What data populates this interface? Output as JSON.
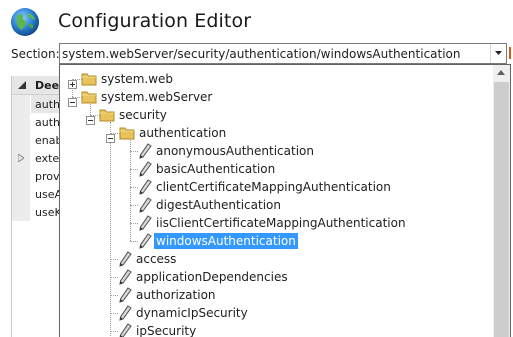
{
  "header": {
    "title": "Configuration Editor",
    "globe_icon": "globe-icon"
  },
  "section": {
    "label": "Section:",
    "value": "system.webServer/security/authentication/windowsAuthentication"
  },
  "grid": {
    "header": "Dee",
    "rows": [
      "auth",
      "auth",
      "enab",
      "exter",
      "prov",
      "useA",
      "useK"
    ]
  },
  "tree": {
    "items": [
      {
        "label": "system.web",
        "type": "folder",
        "level": 1,
        "toggle": "+"
      },
      {
        "label": "system.webServer",
        "type": "folder",
        "level": 1,
        "toggle": "-"
      },
      {
        "label": "security",
        "type": "folder",
        "level": 2,
        "toggle": "-"
      },
      {
        "label": "authentication",
        "type": "folder",
        "level": 3,
        "toggle": "-"
      },
      {
        "label": "anonymousAuthentication",
        "type": "section",
        "level": 4
      },
      {
        "label": "basicAuthentication",
        "type": "section",
        "level": 4
      },
      {
        "label": "clientCertificateMappingAuthentication",
        "type": "section",
        "level": 4
      },
      {
        "label": "digestAuthentication",
        "type": "section",
        "level": 4
      },
      {
        "label": "iisClientCertificateMappingAuthentication",
        "type": "section",
        "level": 4
      },
      {
        "label": "windowsAuthentication",
        "type": "section",
        "level": 4,
        "selected": true
      },
      {
        "label": "access",
        "type": "section",
        "level": 3
      },
      {
        "label": "applicationDependencies",
        "type": "section",
        "level": 3
      },
      {
        "label": "authorization",
        "type": "section",
        "level": 3
      },
      {
        "label": "dynamicIpSecurity",
        "type": "section",
        "level": 3
      },
      {
        "label": "ipSecurity",
        "type": "section",
        "level": 3
      }
    ]
  },
  "colors": {
    "selection": "#3399ff",
    "folder": "#e8c25a"
  }
}
